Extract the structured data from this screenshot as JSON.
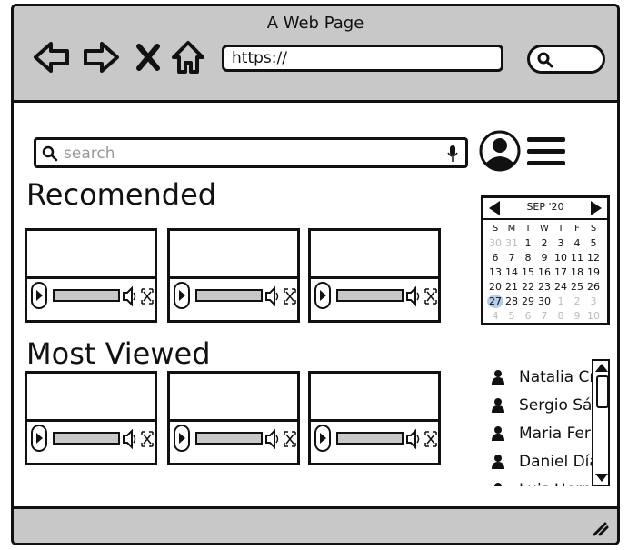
{
  "window": {
    "title": "A Web Page"
  },
  "browser": {
    "url": "https://",
    "icons": [
      "back-arrow-icon",
      "forward-arrow-icon",
      "close-icon",
      "home-icon",
      "search-icon"
    ]
  },
  "header": {
    "search_placeholder": "search"
  },
  "sections": {
    "recommended": {
      "title": "Recomended"
    },
    "most_viewed": {
      "title": "Most Viewed"
    }
  },
  "calendar": {
    "month": "SEP '20",
    "weekdays": [
      "S",
      "M",
      "T",
      "W",
      "T",
      "F",
      "S"
    ],
    "days": [
      {
        "d": "30",
        "m": true
      },
      {
        "d": "31",
        "m": true
      },
      {
        "d": "1"
      },
      {
        "d": "2"
      },
      {
        "d": "3"
      },
      {
        "d": "4"
      },
      {
        "d": "5"
      },
      {
        "d": "6"
      },
      {
        "d": "7"
      },
      {
        "d": "8"
      },
      {
        "d": "9"
      },
      {
        "d": "10"
      },
      {
        "d": "11"
      },
      {
        "d": "12"
      },
      {
        "d": "13"
      },
      {
        "d": "14"
      },
      {
        "d": "15"
      },
      {
        "d": "16"
      },
      {
        "d": "17"
      },
      {
        "d": "18"
      },
      {
        "d": "19"
      },
      {
        "d": "20"
      },
      {
        "d": "21"
      },
      {
        "d": "22"
      },
      {
        "d": "23"
      },
      {
        "d": "24"
      },
      {
        "d": "25"
      },
      {
        "d": "26"
      },
      {
        "d": "27",
        "sel": true
      },
      {
        "d": "28"
      },
      {
        "d": "29"
      },
      {
        "d": "30"
      },
      {
        "d": "1",
        "m": true
      },
      {
        "d": "2",
        "m": true
      },
      {
        "d": "3",
        "m": true
      },
      {
        "d": "4",
        "m": true
      },
      {
        "d": "5",
        "m": true
      },
      {
        "d": "6",
        "m": true
      },
      {
        "d": "7",
        "m": true
      },
      {
        "d": "8",
        "m": true
      },
      {
        "d": "9",
        "m": true
      },
      {
        "d": "10",
        "m": true
      }
    ]
  },
  "users": [
    "Natalia Cruz",
    "Sergio Sánchez",
    "Maria Fernanda",
    "Daniel Díaz",
    "Luis Hernández"
  ],
  "colors": {
    "chrome": "#c8c8c8",
    "selected_day": "#b6cdea",
    "line": "#111111"
  }
}
